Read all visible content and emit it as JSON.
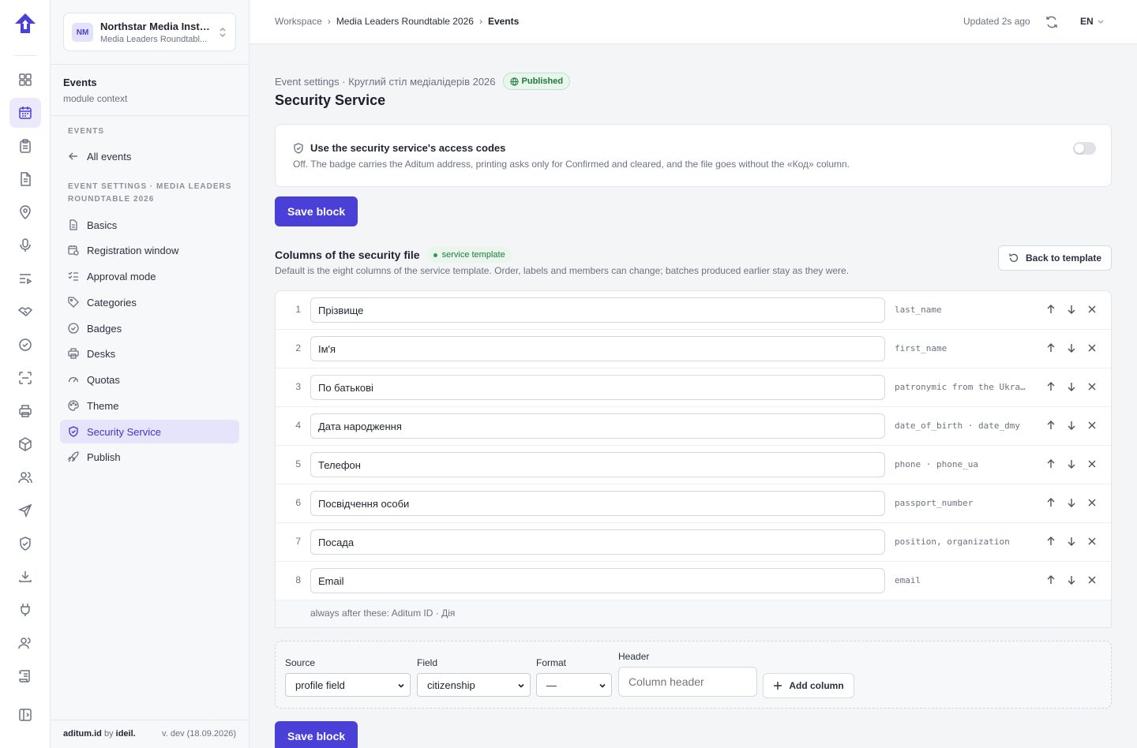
{
  "org": {
    "initials": "NM",
    "name": "Northstar Media Instit...",
    "project": "Media Leaders Roundtabl..."
  },
  "context": {
    "title": "Events",
    "subtitle": "module context"
  },
  "nav": {
    "events_section": "EVENTS",
    "all_events": "All events",
    "settings_section": "EVENT SETTINGS · MEDIA LEADERS ROUNDTABLE 2026",
    "items": [
      {
        "label": "Basics",
        "icon": "document-icon"
      },
      {
        "label": "Registration window",
        "icon": "calendar-clock-icon"
      },
      {
        "label": "Approval mode",
        "icon": "checklist-icon"
      },
      {
        "label": "Categories",
        "icon": "tag-icon"
      },
      {
        "label": "Badges",
        "icon": "badge-check-icon"
      },
      {
        "label": "Desks",
        "icon": "printer-icon"
      },
      {
        "label": "Quotas",
        "icon": "gauge-icon"
      },
      {
        "label": "Theme",
        "icon": "palette-icon"
      },
      {
        "label": "Security Service",
        "icon": "shield-check-icon",
        "active": true
      },
      {
        "label": "Publish",
        "icon": "rocket-icon"
      }
    ]
  },
  "footer": {
    "brand": "aditum.id",
    "by": "by",
    "company": "ideil.",
    "version": "v. dev (18.09.2026)"
  },
  "topbar": {
    "crumbs": [
      "Workspace",
      "Media Leaders Roundtable 2026",
      "Events"
    ],
    "separator": "›",
    "updated": "Updated 2s ago",
    "lang": "EN"
  },
  "page": {
    "eyebrow": "Event settings · Круглий стіл медіалідерів 2026",
    "status": "Published",
    "title": "Security Service"
  },
  "access_codes": {
    "title": "Use the security service's access codes",
    "description": "Off. The badge carries the Aditum address, printing asks only for Confirmed and cleared, and the file goes without the «Код» column.",
    "enabled": false,
    "save_label": "Save block"
  },
  "columns": {
    "title": "Columns of the security file",
    "badge": "service template",
    "description": "Default is the eight columns of the service template. Order, labels and members can change; batches produced earlier stay as they were.",
    "back_label": "Back to template",
    "rows": [
      {
        "num": "1",
        "label": "Прізвище",
        "key": "last_name"
      },
      {
        "num": "2",
        "label": "Ім'я",
        "key": "first_name"
      },
      {
        "num": "3",
        "label": "По батькові",
        "key": "patronymic from the Ukra..."
      },
      {
        "num": "4",
        "label": "Дата народження",
        "key": "date_of_birth · date_dmy"
      },
      {
        "num": "5",
        "label": "Телефон",
        "key": "phone · phone_ua"
      },
      {
        "num": "6",
        "label": "Посвідчення особи",
        "key": "passport_number"
      },
      {
        "num": "7",
        "label": "Посада",
        "key": "position, organization"
      },
      {
        "num": "8",
        "label": "Email",
        "key": "email"
      }
    ],
    "after_note": "always after these: Aditum ID · Дія"
  },
  "add_column": {
    "source_label": "Source",
    "source_value": "profile field",
    "field_label": "Field",
    "field_value": "citizenship",
    "format_label": "Format",
    "format_value": "—",
    "header_label": "Header",
    "header_placeholder": "Column header",
    "add_label": "Add column",
    "save_label": "Save block"
  }
}
